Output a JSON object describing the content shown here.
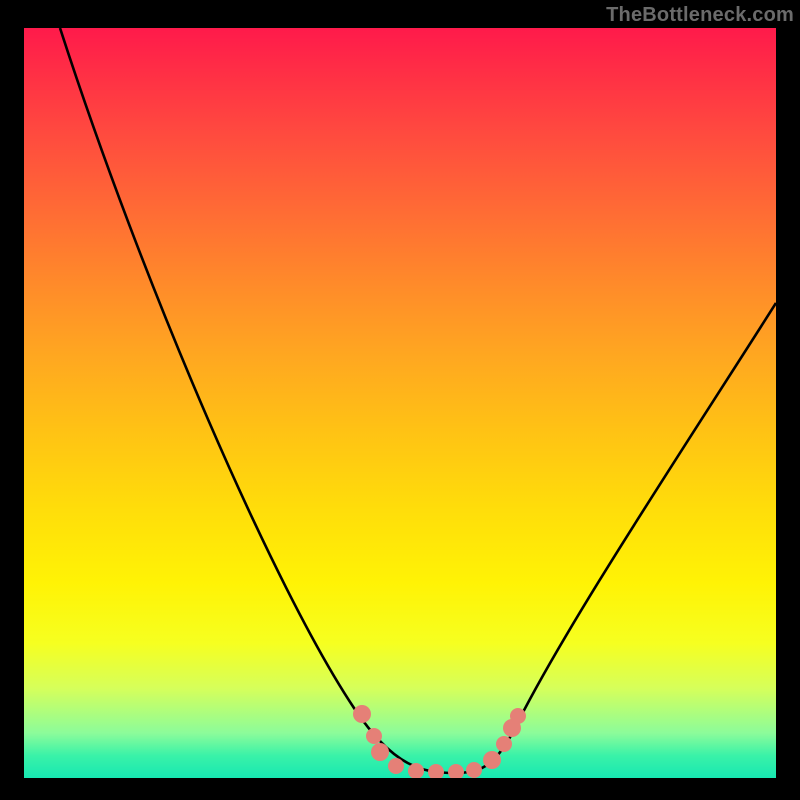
{
  "watermark": "TheBottleneck.com",
  "colors": {
    "frame": "#000000",
    "curve": "#000000",
    "bead": "#e58077",
    "gradient_top": "#ff1a4b",
    "gradient_bottom": "#17e8b2"
  },
  "chart_data": {
    "type": "line",
    "title": "",
    "xlabel": "",
    "ylabel": "",
    "xlim": [
      0,
      100
    ],
    "ylim": [
      0,
      100
    ],
    "grid": false,
    "legend": false,
    "series": [
      {
        "name": "bottleneck_curve",
        "x": [
          5,
          10,
          15,
          20,
          25,
          30,
          35,
          40,
          43,
          46,
          50,
          54,
          58,
          62,
          64,
          67,
          70,
          75,
          80,
          85,
          90,
          95,
          100
        ],
        "values": [
          100,
          89,
          78,
          67,
          56,
          45,
          34,
          22,
          13,
          7,
          3,
          1,
          1,
          1,
          3,
          7,
          13,
          22,
          31,
          39,
          47,
          55,
          63
        ]
      }
    ],
    "annotations": {
      "bead_cluster_x_range": [
        43,
        67
      ],
      "bead_cluster_note": "highlighted data points near curve minimum"
    }
  }
}
